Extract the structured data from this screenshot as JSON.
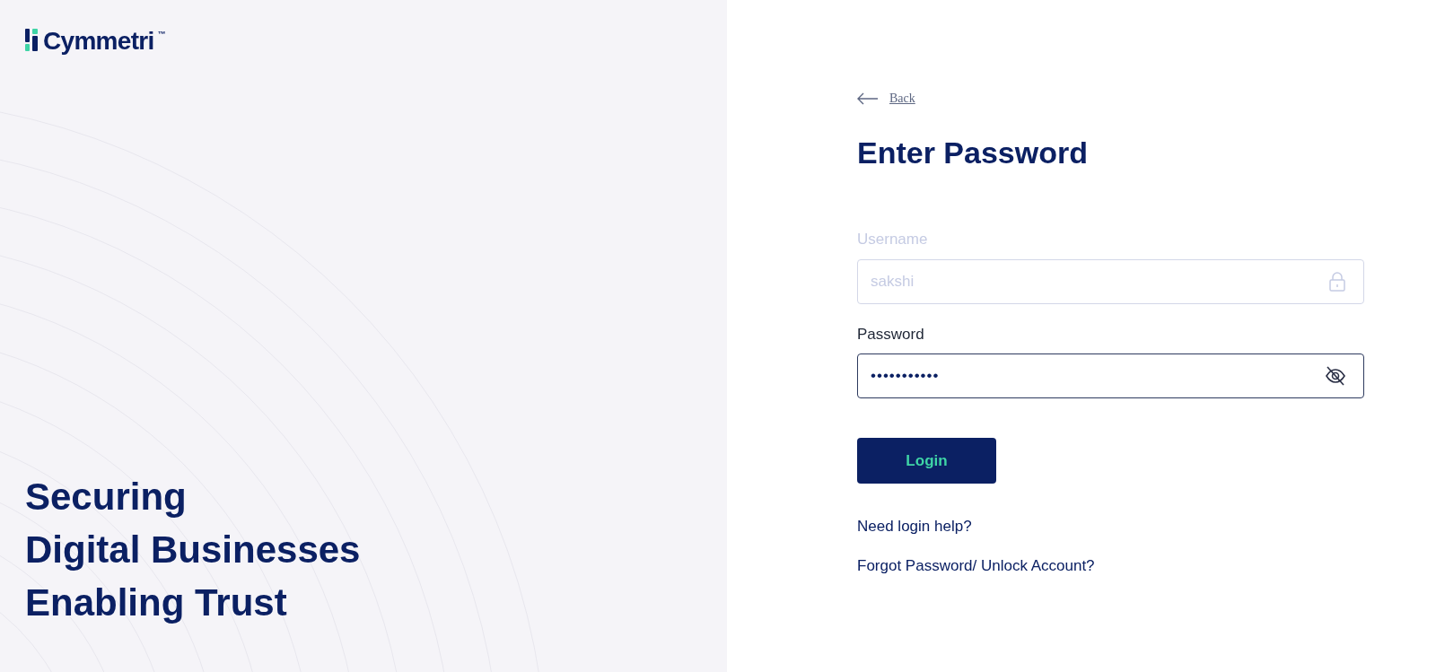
{
  "brand": {
    "name": "Cymmetri",
    "mark": "™"
  },
  "tagline": [
    "Securing",
    "Digital Businesses",
    "Enabling Trust"
  ],
  "back_link": "Back",
  "title": "Enter Password",
  "fields": [
    {
      "label": "Username",
      "value": "sakshi",
      "disabled": true,
      "kind": "locked"
    },
    {
      "label": "Password",
      "value": "•••••••••••",
      "disabled": false,
      "kind": "secret"
    }
  ],
  "login_button": "Login",
  "links": [
    "Need login help?",
    "Forgot Password/ Unlock Account?"
  ]
}
